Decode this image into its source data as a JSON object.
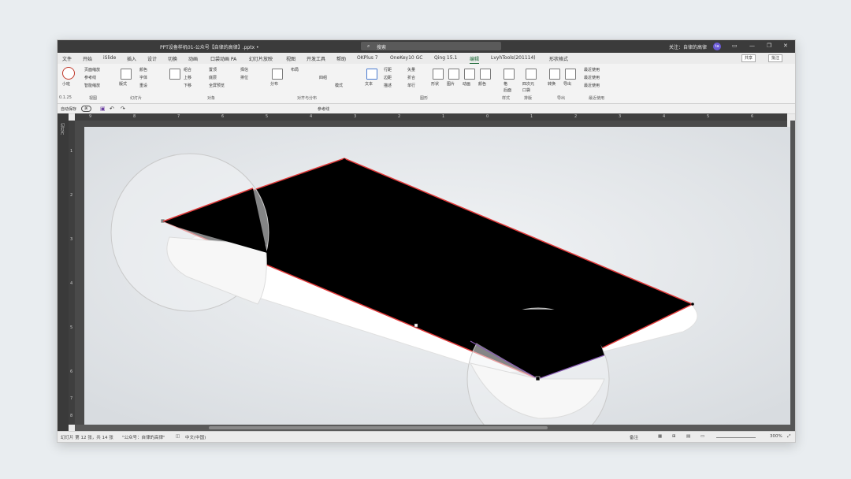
{
  "titlebar": {
    "title": "PPT设备样机01-公众号【自律的高律】.pptx  •",
    "search_placeholder": "搜索",
    "follow_text": "关注：自律的高律",
    "avatar_initial": "ta"
  },
  "tabs": [
    "文件",
    "开始",
    "iSlide",
    "插入",
    "设计",
    "切换",
    "动画",
    "口袋动画 PA",
    "幻灯片放映",
    "视图",
    "开发工具",
    "帮助",
    "OKPlus 7",
    "OneKey10 GC",
    "Qing 15.1",
    "编辑",
    "LvyhTools(201114)",
    "形状格式"
  ],
  "active_tab": "编辑",
  "share_label": "共享",
  "comment_label": "批注",
  "ribbon": {
    "zoom_label": "小班",
    "view_items": [
      "页面缩放",
      "参考线",
      "智能缩放"
    ],
    "groups": [
      "0.1.25",
      "视图",
      "幻灯片",
      "对象",
      "对齐与分布",
      "图形",
      "样式",
      "排版",
      "导出",
      "最近使用"
    ],
    "slide_items": [
      "版式",
      "颜色",
      "字体",
      "重设"
    ],
    "object_items": [
      "组合",
      "上移",
      "下移",
      "置顶",
      "底层",
      "全屏预览",
      "择信",
      "排位"
    ],
    "align_items": [
      "分布",
      "布局",
      "四组",
      "模式"
    ],
    "shape_items": [
      "文本",
      "行距",
      "边距",
      "描述",
      "矢量",
      "折合",
      "单行",
      "形状",
      "图片",
      "动画",
      "颜色",
      "图形"
    ],
    "style_items": [
      "格",
      "后面"
    ],
    "layout_items": [
      "四次元",
      "口袋"
    ],
    "export_items": [
      "转换",
      "导出"
    ],
    "recent_items": [
      "最近使用",
      "最近使用",
      "最近使用"
    ]
  },
  "qat": {
    "autosave": "自动保存",
    "autosave_state": "关",
    "items": [
      "参考线"
    ]
  },
  "leftpanel_label": "幻灯片",
  "ruler_top": [
    "9",
    "8",
    "7",
    "6",
    "5",
    "4",
    "3",
    "2",
    "1",
    "0",
    "1",
    "2",
    "3",
    "4",
    "5",
    "6"
  ],
  "ruler_left": [
    "1",
    "2",
    "3",
    "4",
    "5",
    "6",
    "7",
    "8"
  ],
  "statusbar": {
    "slide_info": "幻灯片 第 12 张，共 14 张",
    "theme": "\"公众号：自律的高律\"",
    "language": "中文(中国)",
    "notes": "备注",
    "zoom": "300%"
  },
  "colors": {
    "titlebar": "#3b3b3b",
    "active_tab": "#1d6a38",
    "selection_outline": "#e23b3b",
    "screen": "#000000",
    "device": "#ffffff"
  }
}
